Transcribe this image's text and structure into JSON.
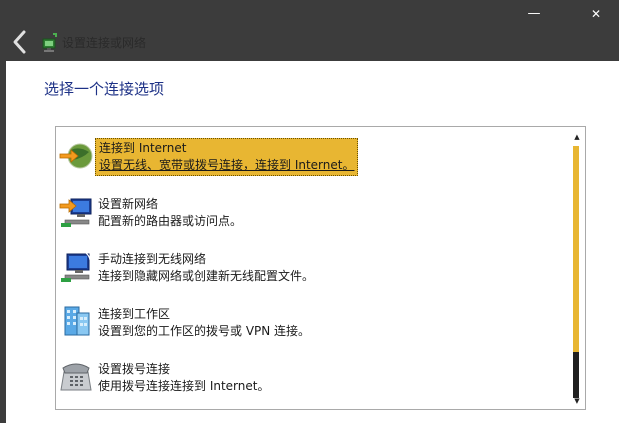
{
  "window": {
    "title": "设置连接或网络",
    "minimize_icon": "minimize-icon",
    "close_icon": "close-icon",
    "min_glyph": "—",
    "close_glyph": "✕"
  },
  "heading": "选择一个连接选项",
  "options": [
    {
      "title": "连接到 Internet",
      "description": "设置无线、宽带或拨号连接，连接到 Internet。",
      "icon": "globe-network-icon",
      "selected": true
    },
    {
      "title": "设置新网络",
      "description": "配置新的路由器或访问点。",
      "icon": "new-network-icon",
      "selected": false
    },
    {
      "title": "手动连接到无线网络",
      "description": "连接到隐藏网络或创建新无线配置文件。",
      "icon": "wireless-network-icon",
      "selected": false
    },
    {
      "title": "连接到工作区",
      "description": "设置到您的工作区的拨号或 VPN 连接。",
      "icon": "workplace-building-icon",
      "selected": false
    },
    {
      "title": "设置拨号连接",
      "description": "使用拨号连接连接到 Internet。",
      "icon": "dialup-phone-icon",
      "selected": false
    }
  ],
  "colors": {
    "selection": "#e8b632",
    "heading": "#1e3287",
    "titlebar": "#3c3c3c"
  }
}
